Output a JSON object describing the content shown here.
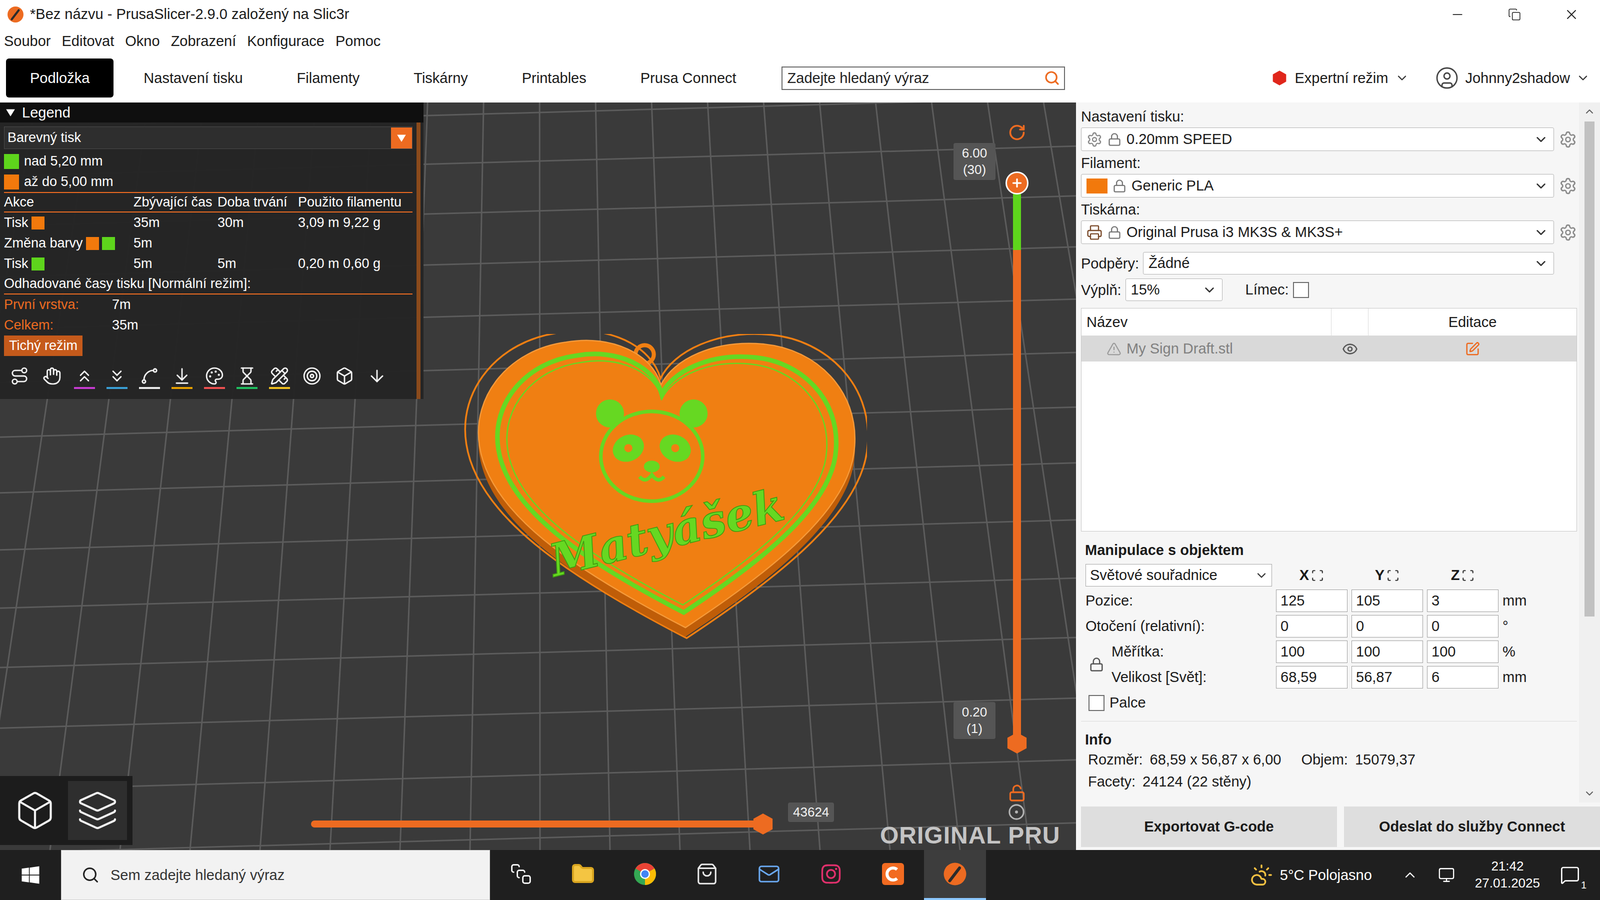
{
  "window": {
    "title": "*Bez názvu - PrusaSlicer-2.9.0 založený na Slic3r"
  },
  "menu": [
    "Soubor",
    "Editovat",
    "Okno",
    "Zobrazení",
    "Konfigurace",
    "Pomoc"
  ],
  "tabs": [
    {
      "label": "Podložka",
      "selected": true
    },
    {
      "label": "Nastavení tisku",
      "selected": false
    },
    {
      "label": "Filamenty",
      "selected": false
    },
    {
      "label": "Tiskárny",
      "selected": false
    },
    {
      "label": "Printables",
      "selected": false
    },
    {
      "label": "Prusa Connect",
      "selected": false
    }
  ],
  "search": {
    "placeholder": "Zadejte hledaný výraz"
  },
  "mode": {
    "label": "Expertní režim"
  },
  "user": {
    "name": "Johnny2shadow"
  },
  "legend": {
    "title": "Legend",
    "expanded": true,
    "view_type": "Barevný tisk",
    "ranges": [
      {
        "label": "nad 5,20 mm",
        "color": "#5ed51c"
      },
      {
        "label": "až do 5,00 mm",
        "color": "#f2790c"
      }
    ],
    "columns": [
      "Akce",
      "Zbývající čas",
      "Doba trvání",
      "Použito filamentu"
    ],
    "rows": [
      {
        "action": "Tisk",
        "colors": [
          "#f2790c"
        ],
        "remaining": "35m",
        "duration": "30m",
        "used": "3,09 m 9,22 g"
      },
      {
        "action": "Změna barvy",
        "colors": [
          "#f2790c",
          "#5ed51c"
        ],
        "remaining": "5m"
      },
      {
        "action": "Tisk",
        "colors": [
          "#5ed51c"
        ],
        "remaining": "5m",
        "duration": "5m",
        "used": "0,20 m 0,60 g"
      }
    ],
    "times_title": "Odhadované časy tisku [Normální režim]:",
    "times": [
      {
        "label": "První vrstva:",
        "value": "7m"
      },
      {
        "label": "Celkem:",
        "value": "35m"
      }
    ],
    "mode_button": "Tichý režim"
  },
  "viewport": {
    "model_text": "Matyášek",
    "bed_label": "ORIGINAL PRU",
    "layer_slider": {
      "top_label": "6.00",
      "top_layer": "(30)",
      "bottom_label": "0.20",
      "bottom_layer": "(1)",
      "upper_level": 1,
      "lower_level": 0,
      "color_change_level": 0.88
    },
    "move_slider": {
      "label": "43624",
      "level": 1
    },
    "view_buttons": [
      {
        "kind": "3d",
        "selected": false
      },
      {
        "kind": "layers",
        "selected": true
      }
    ]
  },
  "right_panel": {
    "presets": [
      {
        "label": "Nastavení tisku:",
        "value": "0.20mm SPEED",
        "kind": "print"
      },
      {
        "label": "Filament:",
        "value": "Generic PLA",
        "kind": "filament",
        "color": "#f2790c"
      },
      {
        "label": "Tiskárna:",
        "value": "Original Prusa i3 MK3S & MK3S+",
        "kind": "printer"
      }
    ],
    "supports": {
      "label": "Podpěry:",
      "value": "Žádné"
    },
    "infill": {
      "label": "Výplň:",
      "value": "15%"
    },
    "brim": {
      "label": "Límec:",
      "checked": false
    },
    "object_list": {
      "columns": [
        "Název",
        "Editace"
      ],
      "rows": [
        {
          "name": "My Sign Draft.stl",
          "selected": true,
          "warning": true,
          "visible": true
        }
      ]
    },
    "manipulation": {
      "title": "Manipulace s objektem",
      "coordinates": "Světové souřadnice",
      "axes": [
        "X",
        "Y",
        "Z"
      ],
      "rows": [
        {
          "label": "Pozice:",
          "values": [
            "125",
            "105",
            "3"
          ],
          "unit": "mm",
          "kind": "plain"
        },
        {
          "label": "Otočení (relativní):",
          "values": [
            "0",
            "0",
            "0"
          ],
          "unit": "°",
          "kind": "plain"
        },
        {
          "label": "Měřítka:",
          "values": [
            "100",
            "100",
            "100"
          ],
          "unit": "%",
          "kind": "scaled"
        },
        {
          "label": "Velikost [Svět]:",
          "values": [
            "68,59",
            "56,87",
            "6"
          ],
          "unit": "mm",
          "kind": "scaled"
        }
      ],
      "inches": {
        "label": "Palce",
        "checked": false
      }
    },
    "info": {
      "title": "Info",
      "rows": [
        [
          {
            "label": "Rozměr:",
            "value": "68,59 x 56,87 x 6,00"
          },
          {
            "label": "Objem:",
            "value": "15079,37"
          }
        ],
        [
          {
            "label": "Facety:",
            "value": "24124 (22 stěny)"
          }
        ]
      ]
    },
    "buttons": [
      "Exportovat G-code",
      "Odeslat do služby Connect"
    ]
  },
  "taskbar": {
    "search": "Sem zadejte hledaný výraz",
    "apps": [
      {
        "kind": "taskview",
        "active": false
      },
      {
        "kind": "explorer",
        "active": false
      },
      {
        "kind": "chrome",
        "active": false
      },
      {
        "kind": "store",
        "active": false
      },
      {
        "kind": "mail",
        "active": false
      },
      {
        "kind": "instagram",
        "active": false
      },
      {
        "kind": "capp",
        "active": false
      },
      {
        "kind": "prusaslicer",
        "active": true
      }
    ],
    "weather": "5°C Polojasno",
    "time": "21:42",
    "date": "27.01.2025",
    "notifications": "1"
  }
}
